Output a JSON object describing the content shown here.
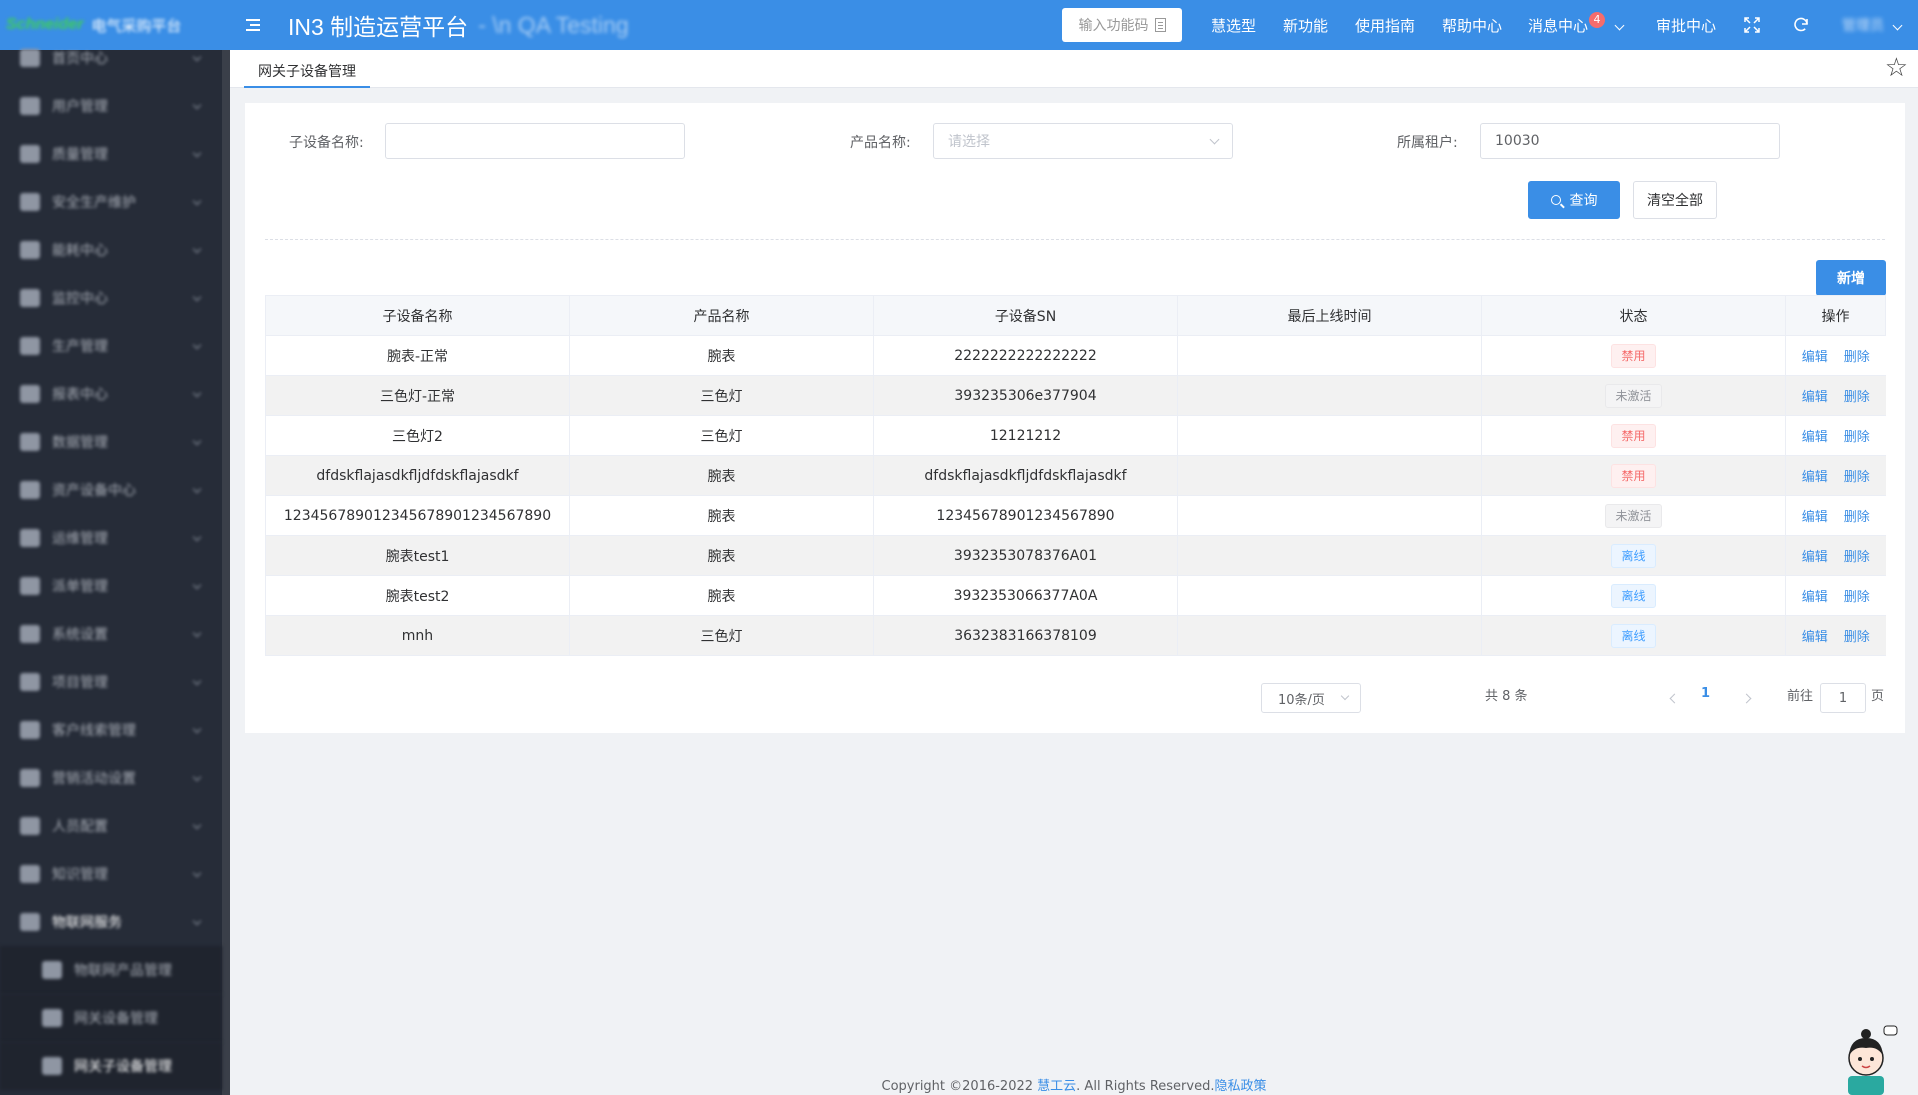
{
  "brand": {
    "logo": "Schneider",
    "text": "电气采购平台"
  },
  "header": {
    "title": "IN3 制造运营平台",
    "subtitle": "- \\n QA Testing",
    "func_code_placeholder": "输入功能码",
    "nav": [
      "慧选型",
      "新功能",
      "使用指南",
      "帮助中心",
      "消息中心",
      "审批中心"
    ],
    "message_badge": "4",
    "user": "管理员"
  },
  "sidebar": {
    "items": [
      "首页中心",
      "用户管理",
      "质量管理",
      "安全生产维护",
      "能耗中心",
      "监控中心",
      "生产管理",
      "报表中心",
      "数据管理",
      "资产设备中心",
      "运维管理",
      "派单管理",
      "系统设置",
      "项目管理",
      "客户线索管理",
      "营销活动设置",
      "人员配置",
      "知识管理",
      "物联网服务"
    ],
    "sub_items": [
      "物联网产品管理",
      "网关设备管理",
      "网关子设备管理"
    ]
  },
  "tab": {
    "label": "网关子设备管理"
  },
  "filters": {
    "name_label": "子设备名称:",
    "name_value": "",
    "product_label": "产品名称:",
    "product_placeholder": "请选择",
    "tenant_label": "所属租户:",
    "tenant_value": "10030",
    "query_button": "查询",
    "clear_button": "清空全部"
  },
  "add_button": "新增",
  "table": {
    "headers": [
      "子设备名称",
      "产品名称",
      "子设备SN",
      "最后上线时间",
      "状态",
      "操作"
    ],
    "rows": [
      {
        "name": "腕表-正常",
        "product": "腕表",
        "sn": "2222222222222222",
        "last_online": "",
        "status": "禁用",
        "status_type": "danger"
      },
      {
        "name": "三色灯-正常",
        "product": "三色灯",
        "sn": "393235306e377904",
        "last_online": "",
        "status": "未激活",
        "status_type": "info"
      },
      {
        "name": "三色灯2",
        "product": "三色灯",
        "sn": "12121212",
        "last_online": "",
        "status": "禁用",
        "status_type": "danger"
      },
      {
        "name": "dfdskflajasdkfljdfdskflajasdkf",
        "product": "腕表",
        "sn": "dfdskflajasdkfljdfdskflajasdkf",
        "last_online": "",
        "status": "禁用",
        "status_type": "danger"
      },
      {
        "name": "123456789012345678901234567890",
        "product": "腕表",
        "sn": "12345678901234567890",
        "last_online": "",
        "status": "未激活",
        "status_type": "info"
      },
      {
        "name": "腕表test1",
        "product": "腕表",
        "sn": "3932353078376A01",
        "last_online": "",
        "status": "离线",
        "status_type": "primary"
      },
      {
        "name": "腕表test2",
        "product": "腕表",
        "sn": "3932353066377A0A",
        "last_online": "",
        "status": "离线",
        "status_type": "primary"
      },
      {
        "name": "mnh",
        "product": "三色灯",
        "sn": "3632383166378109",
        "last_online": "",
        "status": "离线",
        "status_type": "primary"
      }
    ],
    "edit_label": "编辑",
    "delete_label": "删除"
  },
  "pagination": {
    "total": "共 8 条",
    "page_size": "10条/页",
    "current_page": "1",
    "goto_label": "前往",
    "goto_value": "1",
    "page_unit": "页"
  },
  "footer": {
    "copyright": "Copyright ©2016-2022 ",
    "company": "慧工云",
    "rights": ". All Rights Reserved.",
    "privacy": "隐私政策"
  },
  "colors": {
    "primary": "#3a8ee6",
    "sidebar_bg": "#262c38",
    "danger": "#f56c6c"
  }
}
